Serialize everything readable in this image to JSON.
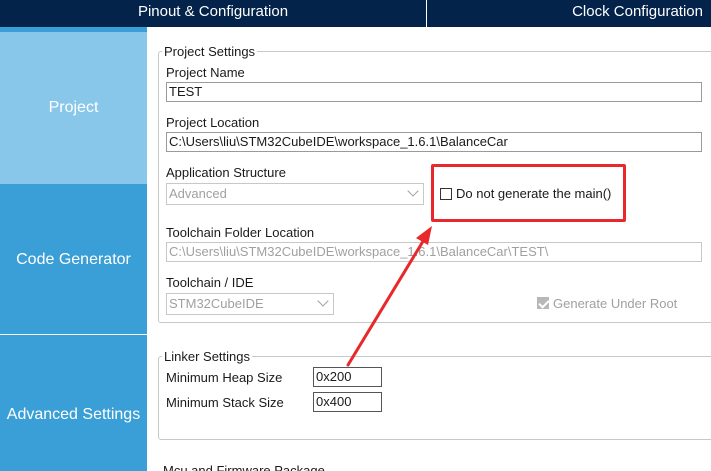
{
  "tabs": {
    "pinout": "Pinout & Configuration",
    "clock": "Clock Configuration"
  },
  "sidebar": {
    "items": [
      {
        "label": "Project"
      },
      {
        "label": "Code Generator"
      },
      {
        "label": "Advanced Settings"
      }
    ]
  },
  "project_settings": {
    "legend": "Project Settings",
    "project_name_label": "Project Name",
    "project_name_value": "TEST",
    "project_location_label": "Project Location",
    "project_location_value": "C:\\Users\\liu\\STM32CubeIDE\\workspace_1.6.1\\BalanceCar",
    "app_structure_label": "Application Structure",
    "app_structure_value": "Advanced",
    "do_not_generate_main_label": "Do not generate the main()",
    "do_not_generate_main_checked": false,
    "toolchain_folder_label": "Toolchain Folder Location",
    "toolchain_folder_value": "C:\\Users\\liu\\STM32CubeIDE\\workspace_1.6.1\\BalanceCar\\TEST\\",
    "toolchain_ide_label": "Toolchain / IDE",
    "toolchain_ide_value": "STM32CubeIDE",
    "generate_under_root_label": "Generate Under Root",
    "generate_under_root_checked": true
  },
  "linker_settings": {
    "legend": "Linker Settings",
    "min_heap_label": "Minimum Heap Size",
    "min_heap_value": "0x200",
    "min_stack_label": "Minimum Stack Size",
    "min_stack_value": "0x400"
  },
  "mcu_firmware": {
    "legend": "Mcu and Firmware Package"
  },
  "colors": {
    "topbar": "#03234b",
    "sidebar": "#3a9fd6",
    "sidebar_active": "#88c7ea",
    "annotation": "#e8282a"
  }
}
